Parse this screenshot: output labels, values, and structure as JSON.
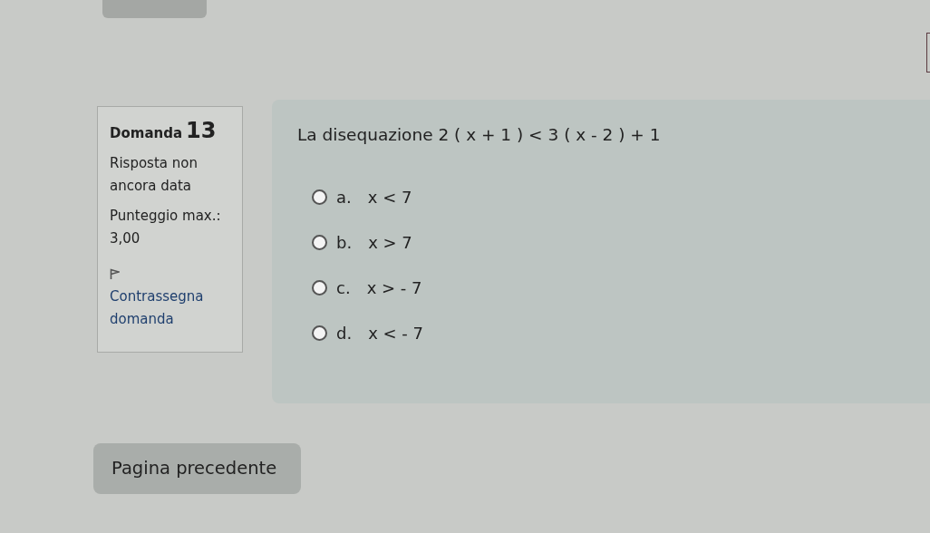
{
  "info": {
    "title": "Domanda",
    "number": "13",
    "status": "Risposta non ancora data",
    "grade_label": "Punteggio max.:",
    "grade_value": "3,00",
    "flag_link": "Contrassegna domanda",
    "flagged": false
  },
  "question": {
    "text": "La disequazione 2 ( x + 1 ) < 3 ( x - 2 ) + 1",
    "options": [
      {
        "letter": "a.",
        "answer": "x < 7",
        "selected": false
      },
      {
        "letter": "b.",
        "answer": "x > 7",
        "selected": false
      },
      {
        "letter": "c.",
        "answer": "x > - 7",
        "selected": false
      },
      {
        "letter": "d.",
        "answer": "x < - 7",
        "selected": false
      }
    ]
  },
  "buttons": [
    {
      "label": "Pagina precedente"
    }
  ]
}
